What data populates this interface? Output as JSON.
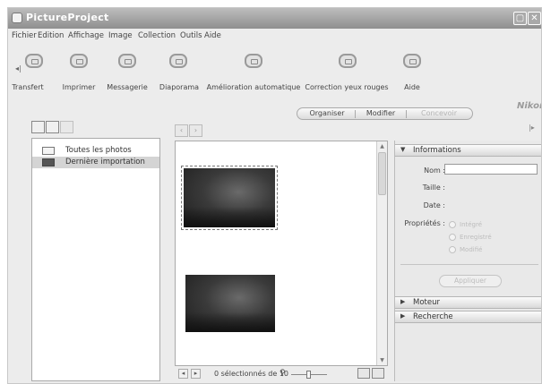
{
  "window": {
    "title": "PictureProject"
  },
  "menu": [
    "Fichier",
    "Edition",
    "Affichage",
    "Image",
    "Collection",
    "Outils",
    "Aide"
  ],
  "toolbar": [
    {
      "label": "Transfert",
      "icon": "transfer-icon"
    },
    {
      "label": "Imprimer",
      "icon": "print-icon"
    },
    {
      "label": "Messagerie",
      "icon": "mail-icon"
    },
    {
      "label": "Diaporama",
      "icon": "slideshow-icon"
    },
    {
      "label": "Amélioration automatique",
      "icon": "auto-enhance-icon"
    },
    {
      "label": "Correction yeux rouges",
      "icon": "red-eye-icon"
    },
    {
      "label": "Aide",
      "icon": "help-icon"
    }
  ],
  "mode_tabs": [
    "Organiser",
    "Modifier",
    "Concevoir"
  ],
  "collections": [
    {
      "label": "Toutes les photos",
      "icon": "photos-icon"
    },
    {
      "label": "Dernière importation",
      "icon": "last-import-icon"
    }
  ],
  "status": {
    "selection": "0 sélectionnés de 10",
    "zoom_value": "2"
  },
  "info_panel": {
    "header": "Informations",
    "name_label": "Nom :",
    "name_value": "",
    "size_label": "Taille :",
    "date_label": "Date :",
    "properties_label": "Propriétés :",
    "radio_options": [
      "Intégré",
      "Enregistré",
      "Modifié"
    ],
    "apply_button": "Appliquer"
  },
  "collapsed_sections": [
    "Moteur",
    "Recherche"
  ],
  "brand": "Nikon",
  "colors": {
    "window_bg": "#ececec",
    "titlebar": "#9a9a9a",
    "panel_bg": "#ffffff"
  }
}
